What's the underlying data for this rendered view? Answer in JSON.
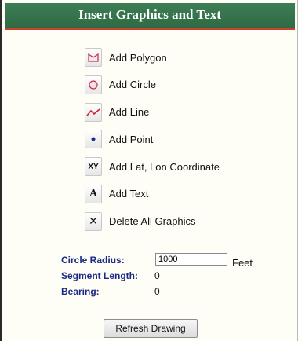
{
  "panel": {
    "title": "Insert Graphics and Text"
  },
  "tools": [
    {
      "label": "Add Polygon",
      "icon": "polygon-icon"
    },
    {
      "label": "Add Circle",
      "icon": "circle-icon"
    },
    {
      "label": "Add Line",
      "icon": "line-icon"
    },
    {
      "label": "Add Point",
      "icon": "point-icon"
    },
    {
      "label": "Add Lat, Lon Coordinate",
      "icon": "xy-coordinate-icon",
      "glyph": "XY"
    },
    {
      "label": "Add Text",
      "icon": "text-icon",
      "glyph": "A"
    },
    {
      "label": "Delete All Graphics",
      "icon": "delete-icon",
      "glyph": "✕"
    }
  ],
  "fields": {
    "circle_radius": {
      "label": "Circle Radius:",
      "value": "1000",
      "unit": "Feet"
    },
    "segment_length": {
      "label": "Segment Length:",
      "value": "0"
    },
    "bearing": {
      "label": "Bearing:",
      "value": "0"
    }
  },
  "refresh_button": {
    "label": "Refresh Drawing"
  },
  "colors": {
    "title_bar": "#2e6a44",
    "title_underline": "#c7432d",
    "field_label": "#1b2a85",
    "line_icon": "#d0202f",
    "point_icon": "#1b2a85"
  }
}
